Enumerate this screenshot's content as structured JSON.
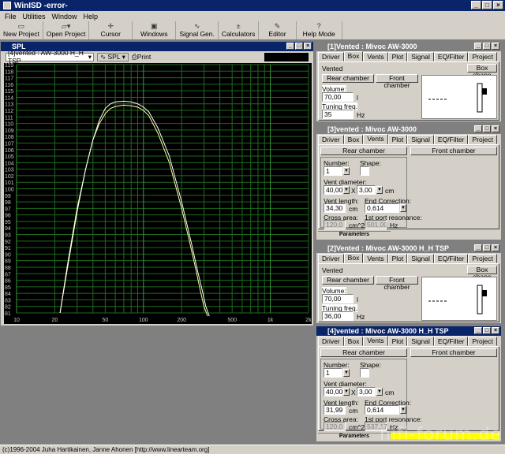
{
  "app": {
    "title": "WinISD -error-"
  },
  "menu": [
    "File",
    "Utilities",
    "Window",
    "Help"
  ],
  "toolbar": [
    {
      "label": "New Project",
      "icon": "new-project-icon"
    },
    {
      "label": "Open Project",
      "icon": "open-project-icon"
    },
    {
      "label": "Cursor",
      "icon": "cursor-icon"
    },
    {
      "label": "Windows",
      "icon": "windows-icon"
    },
    {
      "label": "Signal Gen.",
      "icon": "signal-gen-icon"
    },
    {
      "label": "Calculators",
      "icon": "calculators-icon"
    },
    {
      "label": "Editor",
      "icon": "editor-icon"
    },
    {
      "label": "Help Mode",
      "icon": "help-icon"
    }
  ],
  "spl": {
    "title": "SPL",
    "project_select": "[4]vented : AW-3000 H_H TSP",
    "spl_button": "SPL",
    "print_button": "Print"
  },
  "chart_data": {
    "type": "line",
    "x_scale": "log",
    "xlim": [
      10,
      2000
    ],
    "ylim": [
      81,
      119
    ],
    "x_tick_labels": [
      "10",
      "20",
      "50",
      "100",
      "200",
      "500",
      "1k",
      "2k"
    ],
    "y_tick_labels": [
      "119",
      "118",
      "117",
      "116",
      "115",
      "114",
      "113",
      "112",
      "111",
      "110",
      "109",
      "108",
      "107",
      "106",
      "105",
      "104",
      "103",
      "102",
      "101",
      "100",
      "99",
      "98",
      "97",
      "96",
      "95",
      "94",
      "93",
      "92",
      "91",
      "90",
      "89",
      "88",
      "87",
      "86",
      "85",
      "84",
      "83",
      "82",
      "81"
    ],
    "series": [
      {
        "color": "#ffff99",
        "x": [
          22,
          25,
          30,
          35,
          40,
          45,
          50,
          55,
          60,
          70,
          80,
          90,
          100,
          110,
          130,
          160,
          200,
          230,
          260,
          280,
          300,
          320
        ],
        "y": [
          81,
          88,
          97,
          103,
          107.5,
          110,
          111.5,
          112.3,
          112.6,
          112.8,
          112.7,
          112.5,
          112,
          111.2,
          108.5,
          104,
          97,
          92,
          87.5,
          84.5,
          82,
          80
        ]
      },
      {
        "color": "#ffffff",
        "x": [
          22,
          25,
          30,
          35,
          40,
          45,
          50,
          55,
          60,
          70,
          80,
          90,
          100,
          110,
          130,
          160,
          200,
          240,
          270,
          290,
          310,
          330
        ],
        "y": [
          81,
          87.5,
          96.5,
          103,
          107.5,
          110.5,
          112.3,
          113,
          113.3,
          113.4,
          113.3,
          113,
          112.5,
          111.8,
          109.3,
          105,
          98,
          91.5,
          87,
          84.5,
          82,
          80
        ]
      }
    ]
  },
  "status_bar": "(c)1996-2004 Juha Hartikainen, Janne Ahonen [http://www.linearteam.org]",
  "watermark": "hifi-forum.de",
  "panes": {
    "p1": {
      "title": "[1]Vented : Mivoc AW-3000",
      "tabs": [
        "Driver",
        "Box",
        "Vents",
        "Plot",
        "Signal",
        "EQ/Filter",
        "Project"
      ],
      "selected_tab": "Box",
      "box_type": "Vented",
      "box_shape_btn": "Box shape",
      "rear_btn": "Rear chamber",
      "front_btn": "Front chamber",
      "volume_label": "Volume:",
      "volume": "70,00",
      "volume_unit": "l",
      "tuning_label": "Tuning freq.",
      "tuning": "35",
      "tuning_unit": "Hz"
    },
    "p3": {
      "title": "[3]vented : Mivoc AW-3000",
      "tabs": [
        "Driver",
        "Box",
        "Vents",
        "Plot",
        "Signal",
        "EQ/Filter",
        "Project"
      ],
      "selected_tab": "Vents",
      "rear_btn": "Rear chamber",
      "front_btn": "Front chamber",
      "number_label": "Number:",
      "number": "1",
      "shape_label": "Shape:",
      "diam_label": "Vent diameter:",
      "diam1": "40,00",
      "diam_x": "X",
      "diam2": "3,00",
      "diam_unit": "cm",
      "length_label": "Vent length:",
      "length": "34,30",
      "length_unit": "cm",
      "endcorr_label": "End Correction:",
      "endcorr": "0,614",
      "cross_label": "Cross area:",
      "cross": "120,0",
      "cross_unit": "cm^2",
      "resonance_label": "1st port resonance:",
      "resonance": "501,00",
      "resonance_unit": "Hz",
      "strip": "Parameters"
    },
    "p2": {
      "title": "[2]Vented : Mivoc AW-3000 H_H TSP",
      "tabs": [
        "Driver",
        "Box",
        "Vents",
        "Plot",
        "Signal",
        "EQ/Filter",
        "Project"
      ],
      "selected_tab": "Box",
      "box_type": "Vented",
      "box_shape_btn": "Box shape",
      "rear_btn": "Rear chamber",
      "front_btn": "Front chamber",
      "volume_label": "Volume:",
      "volume": "70,00",
      "volume_unit": "l",
      "tuning_label": "Tuning freq.",
      "tuning": "36,00",
      "tuning_unit": "Hz"
    },
    "p4": {
      "title": "[4]vented : Mivoc AW-3000 H_H TSP",
      "tabs": [
        "Driver",
        "Box",
        "Vents",
        "Plot",
        "Signal",
        "EQ/Filter",
        "Project"
      ],
      "selected_tab": "Vents",
      "rear_btn": "Rear chamber",
      "front_btn": "Front chamber",
      "number_label": "Number:",
      "number": "1",
      "shape_label": "Shape:",
      "diam_label": "Vent diameter:",
      "diam1": "40,00",
      "diam_x": "X",
      "diam2": "3,00",
      "diam_unit": "cm",
      "length_label": "Vent length:",
      "length": "31,99",
      "length_unit": "cm",
      "endcorr_label": "End Correction:",
      "endcorr": "0,614",
      "cross_label": "Cross area:",
      "cross": "120,0",
      "cross_unit": "cm^2",
      "resonance_label": "1st port resonance:",
      "resonance": "537,17",
      "resonance_unit": "Hz",
      "strip": "Parameters"
    }
  }
}
